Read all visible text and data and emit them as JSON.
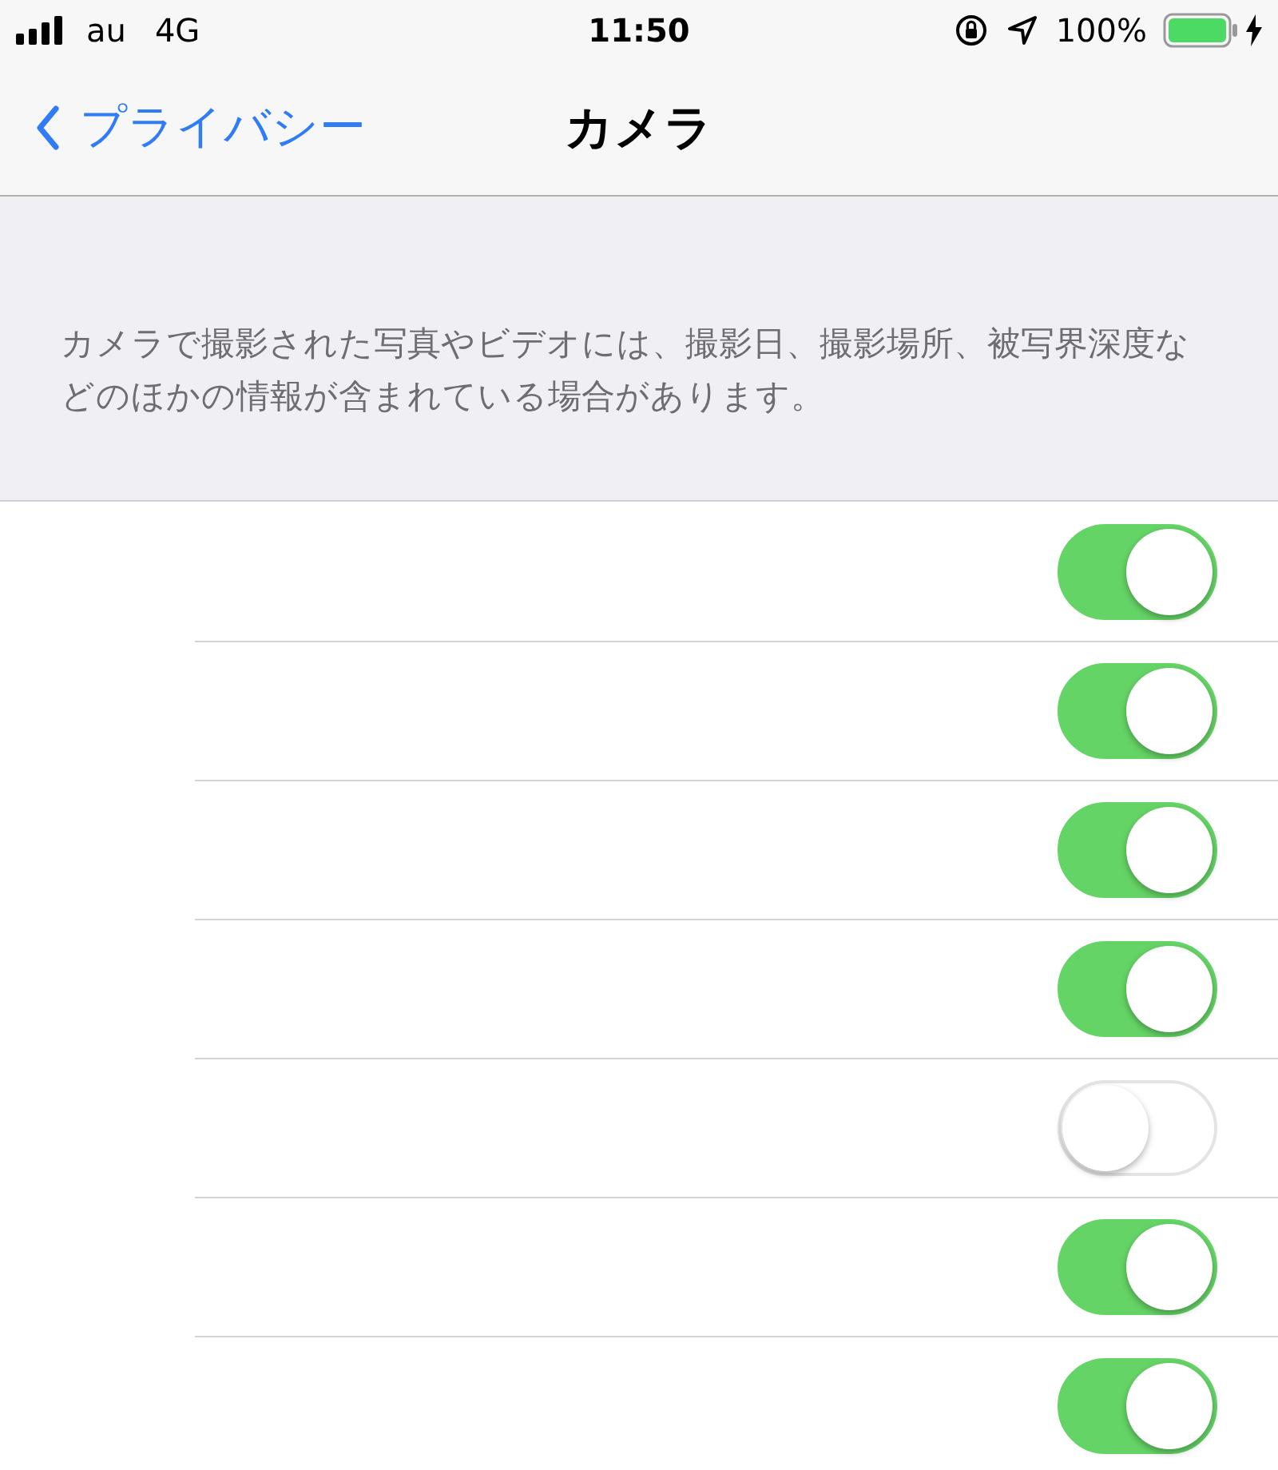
{
  "status_bar": {
    "carrier": "au",
    "network": "4G",
    "time": "11:50",
    "battery": "100%"
  },
  "nav": {
    "back": "プライバシー",
    "title": "カメラ"
  },
  "description": "カメラで撮影された写真やビデオには、撮影日、撮影場所、被写界深度などのほかの情報が含まれている場合があります。",
  "rows": [
    {
      "on": true
    },
    {
      "on": true
    },
    {
      "on": true
    },
    {
      "on": true
    },
    {
      "on": false
    },
    {
      "on": true
    },
    {
      "on": true
    }
  ]
}
